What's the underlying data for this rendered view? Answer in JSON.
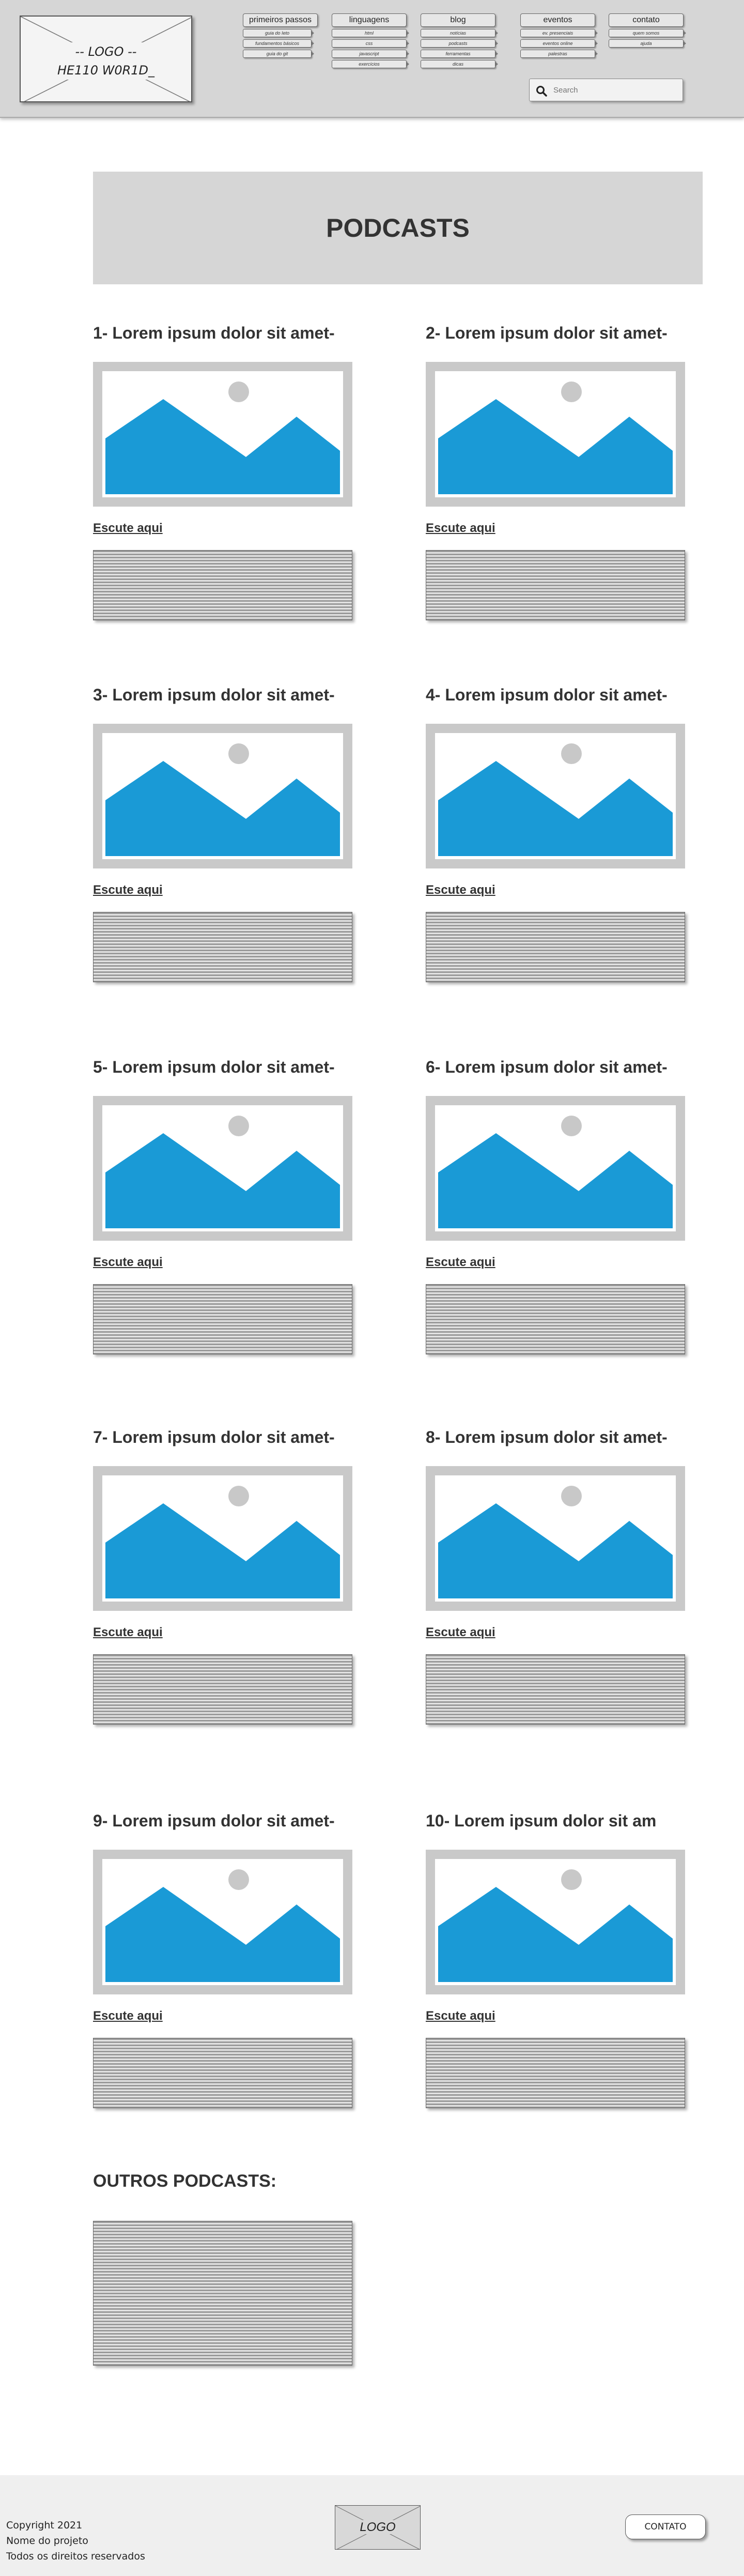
{
  "header": {
    "logo_line1": "-- LOGO --",
    "logo_line2": "HE110 W0R1D_",
    "nav": [
      {
        "label": "primeiros passos",
        "items": [
          "guia do Ieto",
          "fundamentos básicos",
          "guia do git"
        ]
      },
      {
        "label": "linguagens",
        "items": [
          "html",
          "css",
          "javascript",
          "exercícios"
        ]
      },
      {
        "label": "blog",
        "items": [
          "notícias",
          "podcasts",
          "ferramentas",
          "dicas"
        ]
      },
      {
        "label": "eventos",
        "items": [
          "ev. presenciais",
          "eventos online",
          "palestras"
        ]
      },
      {
        "label": "contato",
        "items": [
          "quem somos",
          "ajuda"
        ]
      }
    ],
    "search_placeholder": "Search"
  },
  "main": {
    "page_title": "PODCASTS",
    "listen_label": "Escute aqui",
    "items": [
      {
        "title": "1- Lorem ipsum dolor sit amet-"
      },
      {
        "title": "2- Lorem ipsum dolor sit amet-"
      },
      {
        "title": "3- Lorem ipsum dolor sit amet-"
      },
      {
        "title": "4- Lorem ipsum dolor sit amet-"
      },
      {
        "title": "5- Lorem ipsum dolor sit amet-"
      },
      {
        "title": "6- Lorem ipsum dolor sit amet-"
      },
      {
        "title": "7- Lorem ipsum dolor sit amet-"
      },
      {
        "title": "8- Lorem ipsum dolor sit amet-"
      },
      {
        "title": "9- Lorem ipsum dolor sit amet-"
      },
      {
        "title": "10- Lorem ipsum dolor sit am"
      }
    ],
    "others_title": "OUTROS PODCASTS:"
  },
  "footer": {
    "copyright": "Copyright 2021",
    "project": "Nome do projeto",
    "rights": "Todos os direitos reservados",
    "logo": "LOGO",
    "contact_label": "CONTATO"
  },
  "colors": {
    "image_blue": "#1a9ad6",
    "frame_gray": "#c9c9c9",
    "header_gray": "#d6d6d6"
  }
}
